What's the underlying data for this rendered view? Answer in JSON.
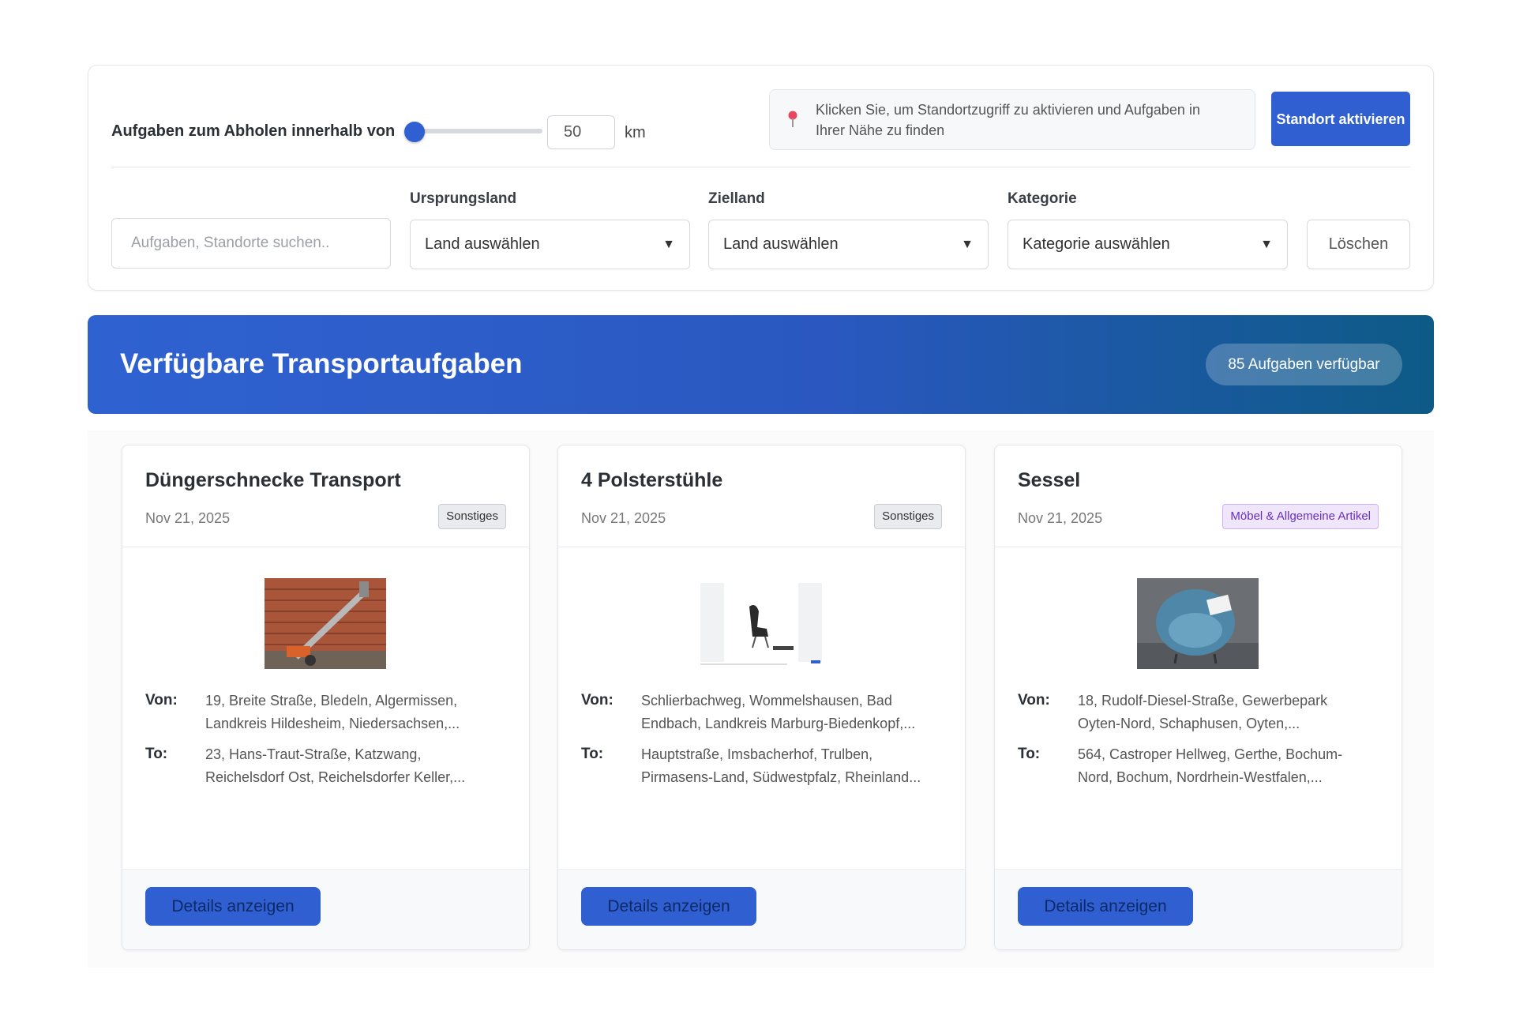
{
  "filters": {
    "radius_label": "Aufgaben zum Abholen innerhalb von",
    "radius_value": "50",
    "radius_unit": "km",
    "location_hint": "Klicken Sie, um Standortzugriff zu aktivieren und Aufgaben in Ihrer Nähe zu finden",
    "locate_button": "Standort aktivieren",
    "search_placeholder": "Aufgaben, Standorte suchen..",
    "origin_label": "Ursprungsland",
    "origin_value": "Land auswählen",
    "destination_label": "Zielland",
    "destination_value": "Land auswählen",
    "category_label": "Kategorie",
    "category_value": "Kategorie auswählen",
    "clear_button": "Löschen",
    "caret": "▼"
  },
  "banner": {
    "title": "Verfügbare Transportaufgaben",
    "count_badge": "85 Aufgaben verfügbar"
  },
  "cards": [
    {
      "title": "Düngerschnecke Transport",
      "date": "Nov 21, 2025",
      "category": "Sonstiges",
      "image": "brick-wall-auger-photo",
      "from_label": "Von:",
      "from": "19, Breite Straße, Bledeln, Algermissen, Landkreis Hildesheim, Niedersachsen,...",
      "to_label": "To:",
      "to": "23, Hans-Traut-Straße, Katzwang, Reichelsdorf Ost, Reichelsdorfer Keller,...",
      "button": "Details anzeigen"
    },
    {
      "title": "4 Polsterstühle",
      "date": "Nov 21, 2025",
      "category": "Sonstiges",
      "image": "chair-screenshot",
      "from_label": "Von:",
      "from": "Schlierbachweg, Wommelshausen, Bad Endbach, Landkreis Marburg-Biedenkopf,...",
      "to_label": "To:",
      "to": "Hauptstraße, Imsbacherhof, Trulben, Pirmasens-Land, Südwestpfalz, Rheinland...",
      "button": "Details anzeigen"
    },
    {
      "title": "Sessel",
      "date": "Nov 21, 2025",
      "category": "Möbel & Allgemeine Artikel",
      "image": "blue-armchair-photo",
      "from_label": "Von:",
      "from": "18, Rudolf-Diesel-Straße, Gewerbepark Oyten-Nord, Schaphusen, Oyten,...",
      "to_label": "To:",
      "to": "564, Castroper Hellweg, Gerthe, Bochum-Nord, Bochum, Nordrhein-Westfalen,...",
      "button": "Details anzeigen"
    }
  ],
  "colors": {
    "accent": "#2f5fd0",
    "banner_start": "#2f62d1",
    "banner_end": "#0d5a86",
    "badge_purple": "#6a2fc2"
  }
}
